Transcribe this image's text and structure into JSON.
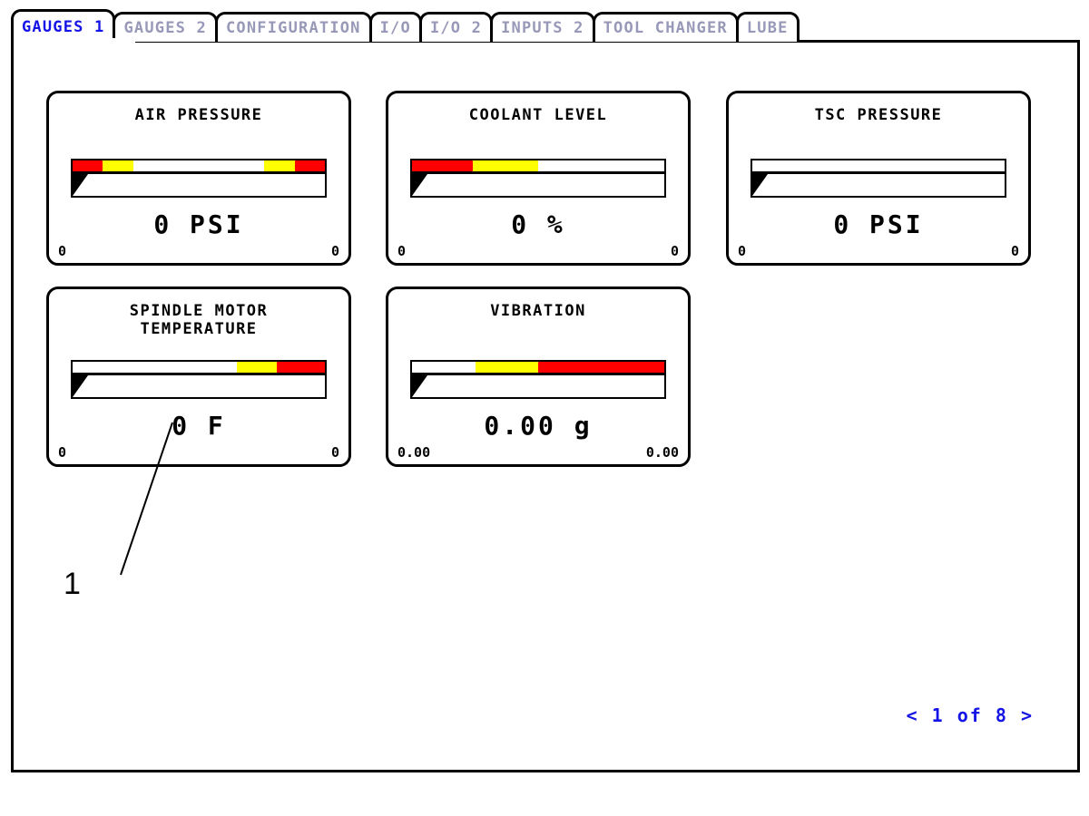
{
  "tabs": [
    {
      "label": "GAUGES 1",
      "active": true
    },
    {
      "label": "GAUGES 2",
      "active": false
    },
    {
      "label": "CONFIGURATION",
      "active": false
    },
    {
      "label": "I/O",
      "active": false
    },
    {
      "label": "I/O 2",
      "active": false
    },
    {
      "label": "INPUTS 2",
      "active": false
    },
    {
      "label": "TOOL CHANGER",
      "active": false
    },
    {
      "label": "LUBE",
      "active": false
    }
  ],
  "colors": {
    "active_tab_text": "#1414e6",
    "inactive_tab_text": "#9898b8",
    "danger": "#ff0000",
    "warning": "#ffff00",
    "normal": "#ffffff",
    "border": "#000000",
    "pagination_text": "#1414e6"
  },
  "gauges": {
    "air_pressure": {
      "title": "AIR PRESSURE",
      "value": "0 PSI",
      "min": "0",
      "max": "0",
      "needle_percent": 0,
      "bands": [
        {
          "color": "#ff0000",
          "width_percent": 12
        },
        {
          "color": "#ffff00",
          "width_percent": 12
        },
        {
          "color": "#ffffff",
          "width_percent": 52
        },
        {
          "color": "#ffff00",
          "width_percent": 12
        },
        {
          "color": "#ff0000",
          "width_percent": 12
        }
      ]
    },
    "coolant_level": {
      "title": "COOLANT LEVEL",
      "value": "0 %",
      "min": "0",
      "max": "0",
      "needle_percent": 0,
      "bands": [
        {
          "color": "#ff0000",
          "width_percent": 24
        },
        {
          "color": "#ffff00",
          "width_percent": 26
        },
        {
          "color": "#ffffff",
          "width_percent": 50
        }
      ]
    },
    "tsc_pressure": {
      "title": "TSC PRESSURE",
      "value": "0 PSI",
      "min": "0",
      "max": "0",
      "needle_percent": 0,
      "bands": [
        {
          "color": "#ffffff",
          "width_percent": 100
        }
      ]
    },
    "spindle_motor_temperature": {
      "title": "SPINDLE MOTOR\nTEMPERATURE",
      "value": "0 F",
      "min": "0",
      "max": "0",
      "needle_percent": 0,
      "bands": [
        {
          "color": "#ffffff",
          "width_percent": 65
        },
        {
          "color": "#ffff00",
          "width_percent": 16
        },
        {
          "color": "#ff0000",
          "width_percent": 19
        }
      ]
    },
    "vibration": {
      "title": "VIBRATION",
      "value": "0.00 g",
      "min": "0.00",
      "max": "0.00",
      "needle_percent": 0,
      "bands": [
        {
          "color": "#ffffff",
          "width_percent": 25
        },
        {
          "color": "#ffff00",
          "width_percent": 25
        },
        {
          "color": "#ff0000",
          "width_percent": 50
        }
      ]
    }
  },
  "callout": {
    "label": "1"
  },
  "pagination": {
    "prev": "<",
    "text": "1 of 8",
    "next": ">"
  }
}
